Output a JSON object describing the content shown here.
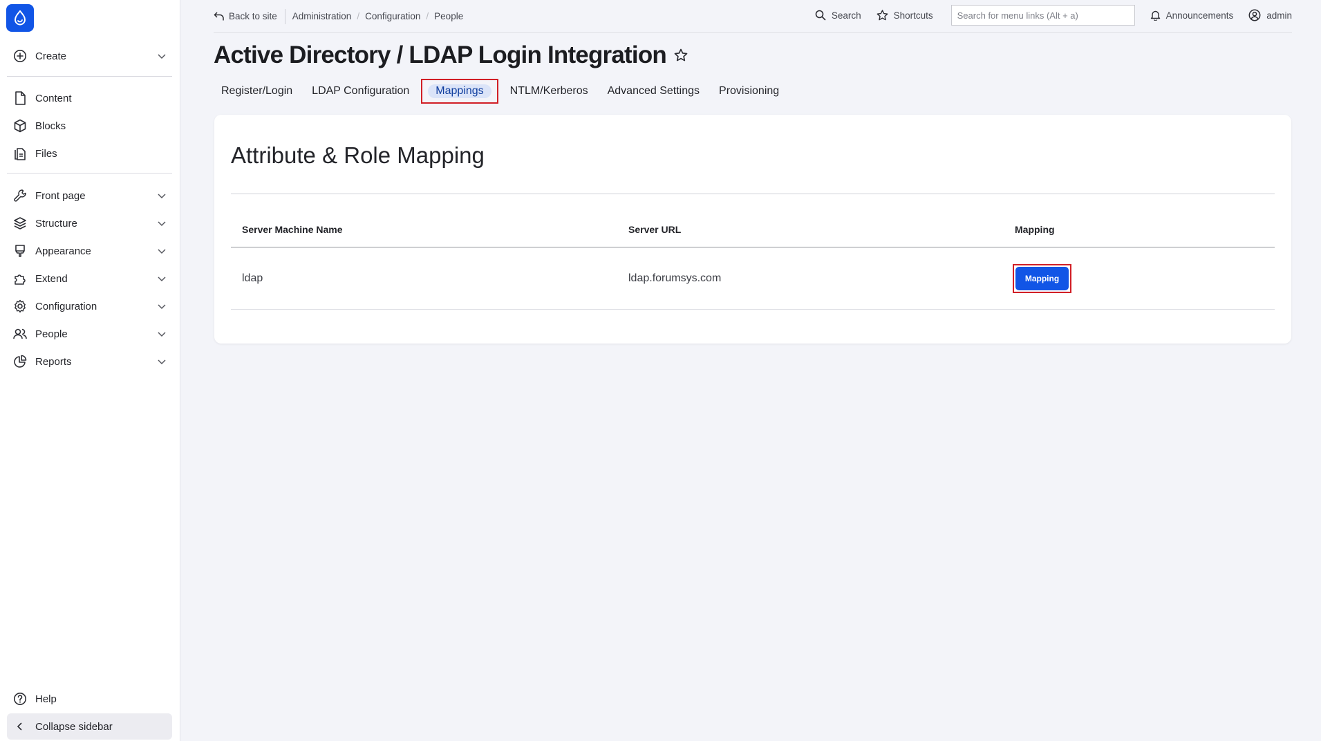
{
  "brand": {
    "accent": "#1155e6",
    "highlight_border": "#d11f26"
  },
  "sidebar": {
    "create": "Create",
    "group1": [
      {
        "label": "Content",
        "icon": "file-icon"
      },
      {
        "label": "Blocks",
        "icon": "cube-icon"
      },
      {
        "label": "Files",
        "icon": "files-icon"
      }
    ],
    "group2": [
      {
        "label": "Front page",
        "icon": "wrench-icon"
      },
      {
        "label": "Structure",
        "icon": "layers-icon"
      },
      {
        "label": "Appearance",
        "icon": "brush-icon"
      },
      {
        "label": "Extend",
        "icon": "puzzle-icon"
      },
      {
        "label": "Configuration",
        "icon": "gear-icon"
      },
      {
        "label": "People",
        "icon": "people-icon"
      },
      {
        "label": "Reports",
        "icon": "pie-chart-icon"
      }
    ],
    "help": "Help",
    "collapse": "Collapse sidebar"
  },
  "topbar": {
    "back": "Back to site",
    "breadcrumbs": [
      "Administration",
      "Configuration",
      "People"
    ],
    "search": "Search",
    "shortcuts": "Shortcuts",
    "menu_search_placeholder": "Search for menu links (Alt + a)",
    "announcements": "Announcements",
    "user": "admin"
  },
  "page": {
    "title": "Active Directory / LDAP Login Integration",
    "tabs": [
      "Register/Login",
      "LDAP Configuration",
      "Mappings",
      "NTLM/Kerberos",
      "Advanced Settings",
      "Provisioning"
    ],
    "active_tab": "Mappings"
  },
  "card": {
    "title": "Attribute & Role Mapping",
    "columns": [
      "Server Machine Name",
      "Server URL",
      "Mapping"
    ],
    "rows": [
      {
        "name": "ldap",
        "url": "ldap.forumsys.com",
        "action": "Mapping"
      }
    ]
  }
}
